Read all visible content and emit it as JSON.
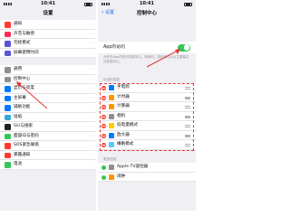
{
  "left": {
    "status_time": "10:41",
    "title": "设置",
    "group1": [
      {
        "label": "通知",
        "icon": "notification-icon",
        "color": "#ff3b30"
      },
      {
        "label": "声音与触感",
        "icon": "sound-icon",
        "color": "#ff2d55"
      },
      {
        "label": "勿扰模式",
        "icon": "moon-icon",
        "color": "#5856d6"
      },
      {
        "label": "屏幕使用时间",
        "icon": "hourglass-icon",
        "color": "#5856d6"
      }
    ],
    "group2": [
      {
        "label": "通用",
        "icon": "gear-icon",
        "color": "#8e8e93"
      },
      {
        "label": "控制中心",
        "icon": "control-center-icon",
        "color": "#8e8e93"
      },
      {
        "label": "显示与亮度",
        "icon": "brightness-icon",
        "color": "#007aff"
      },
      {
        "label": "主屏幕",
        "icon": "home-screen-icon",
        "color": "#007aff"
      },
      {
        "label": "辅助功能",
        "icon": "accessibility-icon",
        "color": "#007aff"
      },
      {
        "label": "墙纸",
        "icon": "wallpaper-icon",
        "color": "#34aadc"
      },
      {
        "label": "Siri与搜索",
        "icon": "siri-icon",
        "color": "#222222"
      },
      {
        "label": "面容ID与密码",
        "icon": "face-id-icon",
        "color": "#34c759"
      },
      {
        "label": "SOS紧急联络",
        "icon": "sos-icon",
        "color": "#ff3b30"
      },
      {
        "label": "暴露通知",
        "icon": "exposure-icon",
        "color": "#ff3b30"
      },
      {
        "label": "电池",
        "icon": "battery-icon",
        "color": "#34c759"
      }
    ]
  },
  "right": {
    "status_time": "10:41",
    "back_label": "设置",
    "title": "控制中心",
    "toggle_label": "App内访问",
    "toggle_on": true,
    "toggle_caption": "允许在App内访问控制中心。停用时，您仍然可以从主屏幕访问控制中心。",
    "included_header": "包含的控制",
    "included": [
      {
        "label": "手电筒",
        "icon": "flashlight-icon",
        "color": "#007aff"
      },
      {
        "label": "计时器",
        "icon": "timer-icon",
        "color": "#ff9500"
      },
      {
        "label": "计算器",
        "icon": "calculator-icon",
        "color": "#ff9500"
      },
      {
        "label": "相机",
        "icon": "camera-icon",
        "color": "#8e8e93"
      },
      {
        "label": "低电量模式",
        "icon": "low-power-icon",
        "color": "#ffcc00"
      },
      {
        "label": "放大器",
        "icon": "magnifier-icon",
        "color": "#007aff"
      },
      {
        "label": "睡眠模式",
        "icon": "sleep-icon",
        "color": "#5ac8fa"
      }
    ],
    "more_header": "更多控制",
    "more": [
      {
        "label": "Apple TV遥控器",
        "icon": "tv-remote-icon",
        "color": "#8e8e93"
      },
      {
        "label": "闹钟",
        "icon": "alarm-icon",
        "color": "#ff9500"
      }
    ]
  },
  "colors": {
    "accent": "#007aff",
    "toggle_on": "#34c759",
    "annotation": "#e53935"
  }
}
